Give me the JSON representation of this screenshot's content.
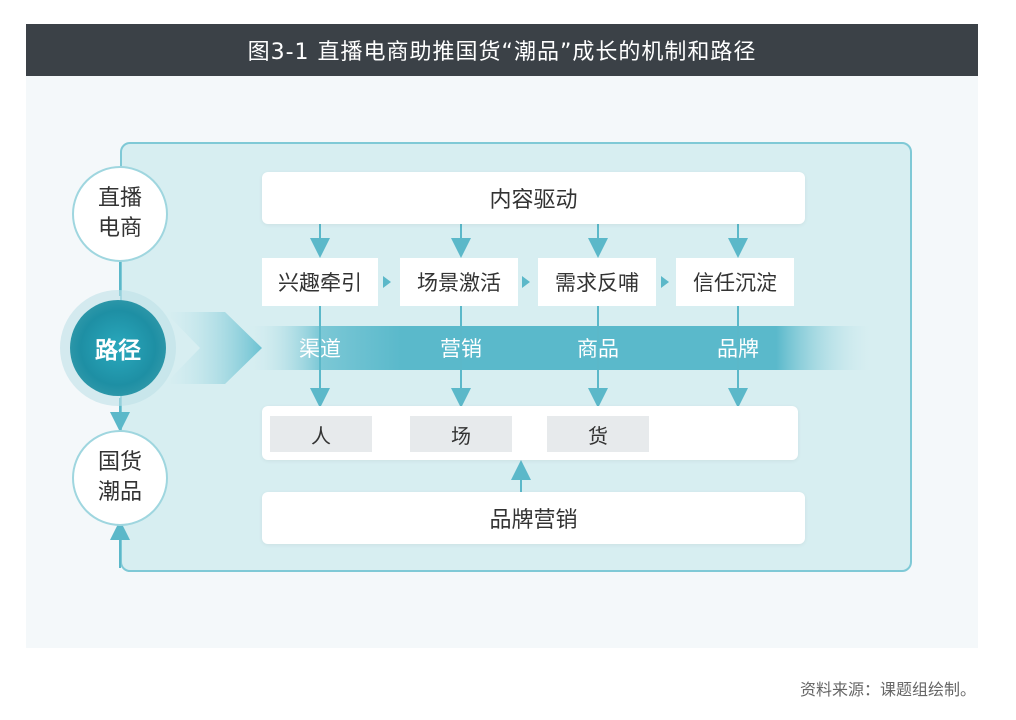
{
  "title": "图3-1 直播电商助推国货“潮品”成长的机制和路径",
  "nodes": {
    "live_commerce": [
      "直播",
      "电商"
    ],
    "path": "路径",
    "guochao": [
      "国货",
      "潮品"
    ]
  },
  "top_box": "内容驱动",
  "stages": [
    "兴趣牵引",
    "场景激活",
    "需求反哺",
    "信任沉淀"
  ],
  "band_labels": [
    "渠道",
    "营销",
    "商品",
    "品牌"
  ],
  "elements": [
    "人",
    "场",
    "货"
  ],
  "bottom_box": "品牌营销",
  "source": "资料来源：课题组绘制。",
  "colors": {
    "title_bg": "#3b4147",
    "frame_border": "#7fc9d6",
    "frame_fill": "#d7eef1",
    "accent": "#2aa9bd",
    "arrow": "#5bb8c9"
  }
}
